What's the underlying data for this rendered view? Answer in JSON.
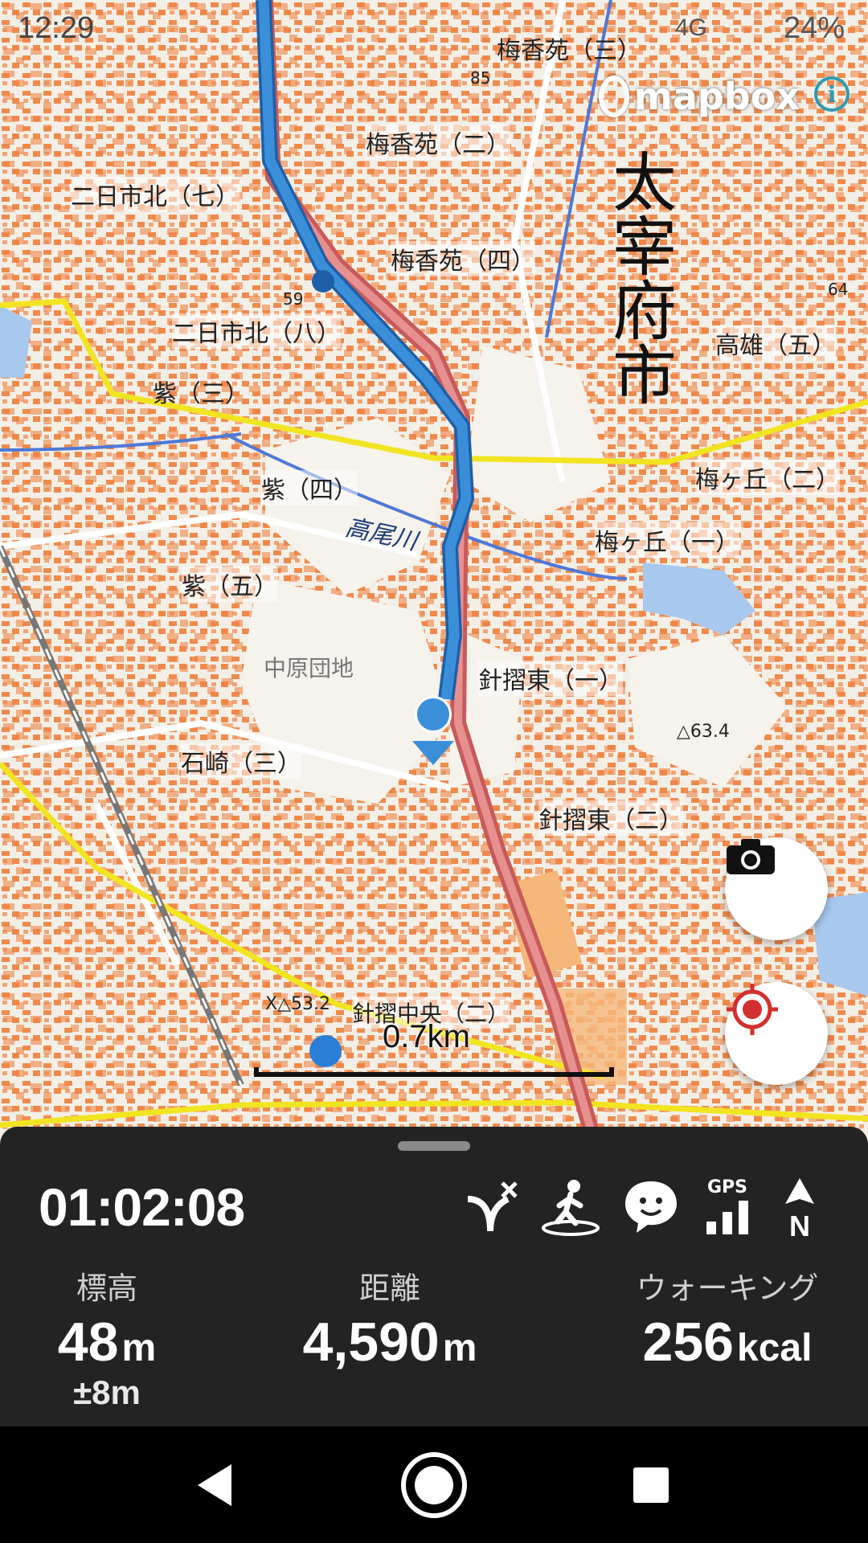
{
  "status_bar": {
    "time": "12:29",
    "network": "4G",
    "battery": "24%"
  },
  "map": {
    "attribution": "mapbox",
    "scale_label": "0.7km",
    "labels": [
      {
        "id": "dazaifu",
        "text": "太宰府市"
      },
      {
        "id": "baikoen2",
        "text": "梅香苑（二）"
      },
      {
        "id": "baikoen3",
        "text": "梅香苑（三）"
      },
      {
        "id": "baikoen4",
        "text": "梅香苑（四）"
      },
      {
        "id": "futsukaichikita7",
        "text": "二日市北（七）"
      },
      {
        "id": "futsukaichikita8",
        "text": "二日市北（八）"
      },
      {
        "id": "murasaki3",
        "text": "紫（三）"
      },
      {
        "id": "murasaki4",
        "text": "紫（四）"
      },
      {
        "id": "murasaki5",
        "text": "紫（五）"
      },
      {
        "id": "takaoriver",
        "text": "高尾川"
      },
      {
        "id": "takao5",
        "text": "高雄（五）"
      },
      {
        "id": "umegaoka1",
        "text": "梅ヶ丘（一）"
      },
      {
        "id": "umegaoka2",
        "text": "梅ヶ丘（二）"
      },
      {
        "id": "nakahara",
        "text": "中原団地"
      },
      {
        "id": "harisurihigashi1",
        "text": "針摺東（一）"
      },
      {
        "id": "harisurihigashi2",
        "text": "針摺東（二）"
      },
      {
        "id": "ishizaki3",
        "text": "石崎（三）"
      },
      {
        "id": "harisurichuo2",
        "text": "針摺中央（二）"
      },
      {
        "id": "elev",
        "text": "△63.4"
      },
      {
        "id": "elev2",
        "text": "X△53.2"
      },
      {
        "id": "n85",
        "text": "85"
      },
      {
        "id": "n59",
        "text": "59"
      },
      {
        "id": "n64",
        "text": "64"
      }
    ]
  },
  "panel": {
    "timer": "01:02:08",
    "stats": [
      {
        "label": "標高",
        "value": "48",
        "unit": "m",
        "sub": "±8m"
      },
      {
        "label": "距離",
        "value": "4,590",
        "unit": "m",
        "sub": ""
      },
      {
        "label": "ウォーキング",
        "value": "256",
        "unit": "kcal",
        "sub": ""
      }
    ],
    "gps_label": "GPS",
    "north_label": "N"
  },
  "colors": {
    "route": "#3b8fd9",
    "rail": "#e07070",
    "panel": "#232323",
    "accent": "#d32f2f"
  }
}
